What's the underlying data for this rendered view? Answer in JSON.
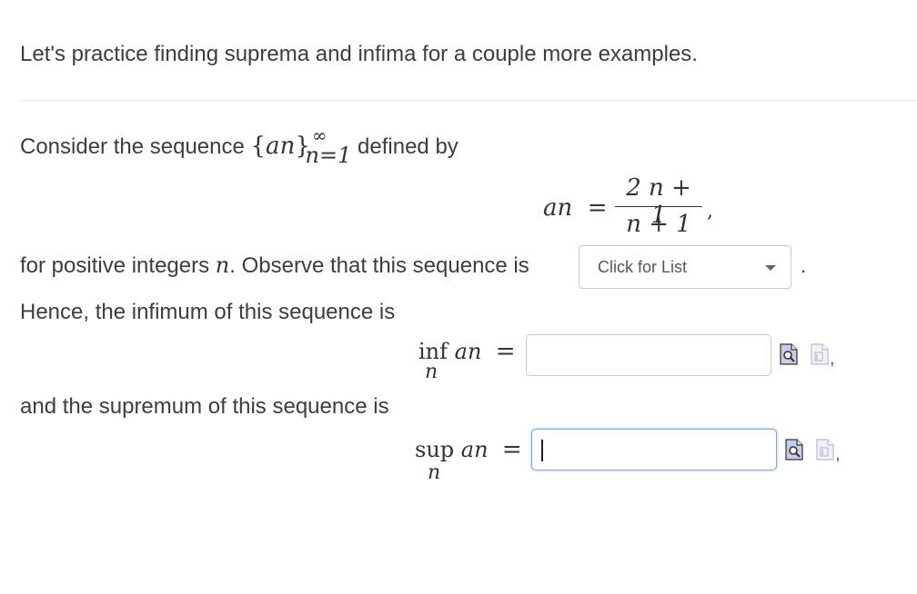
{
  "intro": "Let's practice finding suprema and infima for a couple more examples.",
  "p1": {
    "before": "Consider the sequence ",
    "seq_open": "{",
    "seq_term": "a",
    "seq_sub": "n",
    "seq_close": "}",
    "seq_sup": "∞",
    "seq_index": "n=1",
    "after": " defined by"
  },
  "formula": {
    "lhs_a": "a",
    "lhs_n": "n",
    "equals": "=",
    "numerator": "2 n + 1",
    "denominator": "n + 1",
    "trailing": ","
  },
  "p2": {
    "before": "for positive integers ",
    "var": "n",
    "after": ". Observe that this sequence is",
    "select_label": "Click for List",
    "period": "."
  },
  "p3": "Hence, the infimum of this sequence is",
  "inf_expr": {
    "op": "inf",
    "term_a": "a",
    "term_n": "n",
    "under": "n",
    "equals": "=",
    "value": "",
    "trailing": ","
  },
  "p4": "and the supremum of this sequence is",
  "sup_expr": {
    "op": "sup",
    "term_a": "a",
    "term_n": "n",
    "under": "n",
    "equals": "=",
    "value": "",
    "trailing": ","
  },
  "icons": {
    "preview": "preview-answer-icon",
    "palette": "equation-editor-icon",
    "accent": "#6b6fb8"
  }
}
